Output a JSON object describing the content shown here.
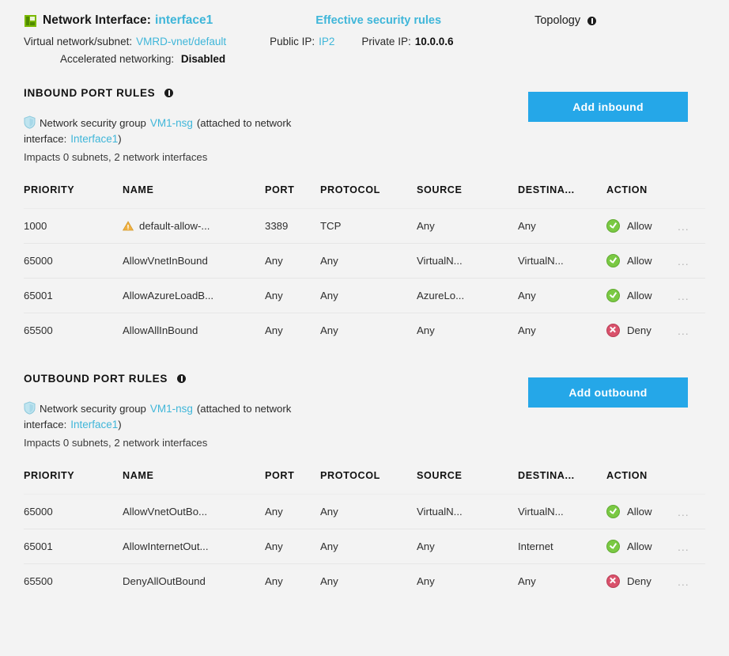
{
  "header": {
    "nic_icon": "network-interface-icon",
    "title_label": "Network Interface:",
    "interface_name": "interface1",
    "effective_rules_link": "Effective security rules",
    "topology_label": "Topology",
    "vnet_label": "Virtual network/subnet:",
    "vnet_value": "VMRD-vnet/default",
    "public_ip_label": "Public IP:",
    "public_ip_value": "IP2",
    "private_ip_label": "Private IP:",
    "private_ip_value": "10.0.0.6",
    "accel_label": "Accelerated networking:",
    "accel_value": "Disabled"
  },
  "colors": {
    "accent_blue": "#25a7e8",
    "link_teal": "#3fb6d9",
    "allow_green": "#7ac943",
    "deny_red": "#d9516b",
    "warn_amber": "#f0b040",
    "page_bg": "#f3f3f3"
  },
  "table_headers": [
    "PRIORITY",
    "NAME",
    "PORT",
    "PROTOCOL",
    "SOURCE",
    "DESTINA...",
    "ACTION"
  ],
  "more_glyph": "...",
  "inbound": {
    "section_title": "INBOUND PORT RULES",
    "nsg_prefix": "Network security group",
    "nsg_name": "VM1-nsg",
    "nsg_attached_text": "(attached to network",
    "nsg_interface_label": "interface:",
    "nsg_interface_name": "Interface1",
    "nsg_paren_close": ")",
    "impacts": "Impacts 0 subnets, 2 network interfaces",
    "add_button": "Add inbound",
    "rows": [
      {
        "priority": "1000",
        "name": "default-allow-...",
        "warn": true,
        "port": "3389",
        "protocol": "TCP",
        "source": "Any",
        "destination": "Any",
        "action": "Allow"
      },
      {
        "priority": "65000",
        "name": "AllowVnetInBound",
        "warn": false,
        "port": "Any",
        "protocol": "Any",
        "source": "VirtualN...",
        "destination": "VirtualN...",
        "action": "Allow"
      },
      {
        "priority": "65001",
        "name": "AllowAzureLoadB...",
        "warn": false,
        "port": "Any",
        "protocol": "Any",
        "source": "AzureLo...",
        "destination": "Any",
        "action": "Allow"
      },
      {
        "priority": "65500",
        "name": "AllowAllInBound",
        "warn": false,
        "port": "Any",
        "protocol": "Any",
        "source": "Any",
        "destination": "Any",
        "action": "Deny"
      }
    ]
  },
  "outbound": {
    "section_title": "OUTBOUND PORT RULES",
    "nsg_prefix": "Network security group",
    "nsg_name": "VM1-nsg",
    "nsg_attached_text": "(attached to network",
    "nsg_interface_label": "interface:",
    "nsg_interface_name": "Interface1",
    "nsg_paren_close": ")",
    "impacts": "Impacts 0 subnets, 2 network interfaces",
    "add_button": "Add outbound",
    "rows": [
      {
        "priority": "65000",
        "name": "AllowVnetOutBo...",
        "warn": false,
        "port": "Any",
        "protocol": "Any",
        "source": "VirtualN...",
        "destination": "VirtualN...",
        "action": "Allow"
      },
      {
        "priority": "65001",
        "name": "AllowInternetOut...",
        "warn": false,
        "port": "Any",
        "protocol": "Any",
        "source": "Any",
        "destination": "Internet",
        "action": "Allow"
      },
      {
        "priority": "65500",
        "name": "DenyAllOutBound",
        "warn": false,
        "port": "Any",
        "protocol": "Any",
        "source": "Any",
        "destination": "Any",
        "action": "Deny"
      }
    ]
  }
}
